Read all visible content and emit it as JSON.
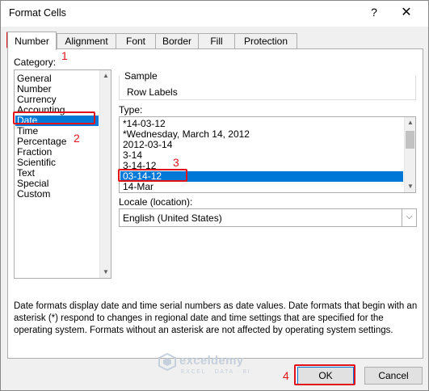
{
  "window": {
    "title": "Format Cells",
    "help_icon": "?",
    "close_icon": "✕"
  },
  "tabs": [
    {
      "label": "Number",
      "active": true
    },
    {
      "label": "Alignment",
      "active": false
    },
    {
      "label": "Font",
      "active": false
    },
    {
      "label": "Border",
      "active": false
    },
    {
      "label": "Fill",
      "active": false
    },
    {
      "label": "Protection",
      "active": false
    }
  ],
  "category": {
    "label": "Category:",
    "items": [
      "General",
      "Number",
      "Currency",
      "Accounting",
      "Date",
      "Time",
      "Percentage",
      "Fraction",
      "Scientific",
      "Text",
      "Special",
      "Custom"
    ],
    "selected": "Date"
  },
  "sample": {
    "label": "Sample",
    "value": "Row Labels"
  },
  "type": {
    "label": "Type:",
    "items": [
      "*14-03-12",
      "*Wednesday, March 14, 2012",
      "2012-03-14",
      "3-14",
      "3-14-12",
      "03-14-12",
      "14-Mar"
    ],
    "selected": "03-14-12"
  },
  "locale": {
    "label": "Locale (location):",
    "value": "English (United States)"
  },
  "description": "Date formats display date and time serial numbers as date values.  Date formats that begin with an asterisk (*) respond to changes in regional date and time settings that are specified for the operating system. Formats without an asterisk are not affected by operating system settings.",
  "buttons": {
    "ok": "OK",
    "cancel": "Cancel"
  },
  "annotations": {
    "step1": "1",
    "step2": "2",
    "step3": "3",
    "step4": "4",
    "highlight_color": "#e0131b"
  },
  "watermark": {
    "name": "exceldemy",
    "tagline": "EXCEL · DATA · BI"
  },
  "colors": {
    "selection": "#0078d7",
    "dialog_bg": "#f0f0f0"
  }
}
